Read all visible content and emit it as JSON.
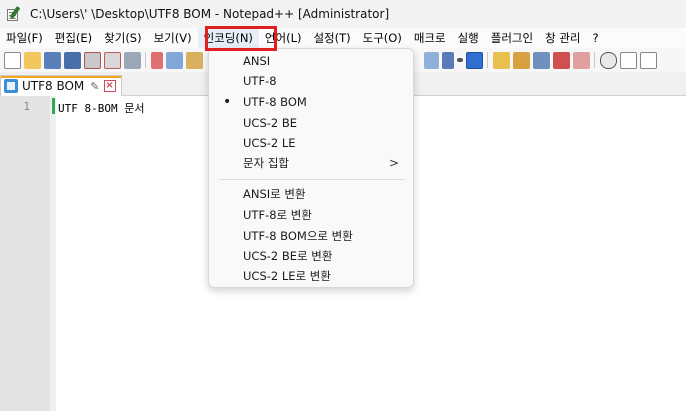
{
  "titlebar": {
    "app_icon": "notepad-icon",
    "title": "C:\\Users\\'       \\Desktop\\UTF8 BOM - Notepad++ [Administrator]"
  },
  "menubar": {
    "items": [
      {
        "label": "파일(F)"
      },
      {
        "label": "편집(E)"
      },
      {
        "label": "찾기(S)"
      },
      {
        "label": "보기(V)"
      },
      {
        "label": "인코딩(N)"
      },
      {
        "label": "언어(L)"
      },
      {
        "label": "설정(T)"
      },
      {
        "label": "도구(O)"
      },
      {
        "label": "매크로"
      },
      {
        "label": "실행"
      },
      {
        "label": "플러그인"
      },
      {
        "label": "창 관리"
      },
      {
        "label": "?"
      }
    ],
    "highlight_color": "#e02020"
  },
  "tab": {
    "label": "UTF8 BOM",
    "pin_icon": "pin-icon",
    "close_icon": "close-icon",
    "accent_color": "#f5a623"
  },
  "editor": {
    "line_number": "1",
    "line_text": "UTF 8-BOM 문서"
  },
  "encoding_menu": {
    "items": [
      {
        "label": "ANSI"
      },
      {
        "label": "UTF-8"
      },
      {
        "label": "UTF-8 BOM"
      },
      {
        "label": "UCS-2 BE"
      },
      {
        "label": "UCS-2 LE"
      },
      {
        "label": "문자 집합"
      },
      {
        "label": "ANSI로 변환"
      },
      {
        "label": "UTF-8로 변환"
      },
      {
        "label": "UTF-8 BOM으로 변환"
      },
      {
        "label": "UCS-2 BE로 변환"
      },
      {
        "label": "UCS-2 LE로 변환"
      }
    ],
    "selected_marker": "•",
    "submenu_arrow": ">"
  }
}
